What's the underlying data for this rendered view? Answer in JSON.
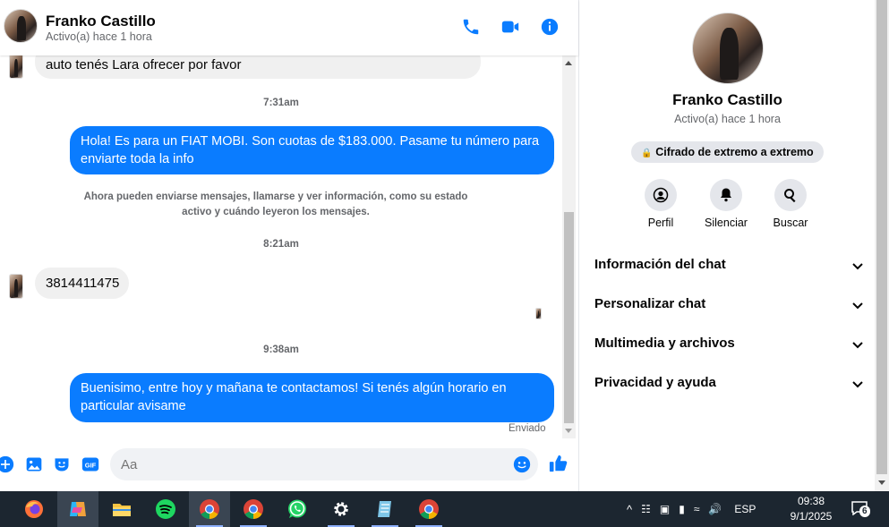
{
  "header": {
    "name": "Franko Castillo",
    "status": "Activo(a) hace 1 hora"
  },
  "messages": {
    "partial_in": "auto tenés Lara ofrecer por favor",
    "time1": "7:31am",
    "out1": "Hola! Es para un FIAT MOBI. Son cuotas de $183.000. Pasame tu número para enviarte toda la info",
    "system": "Ahora pueden enviarse mensajes, llamarse y ver información, como su estado activo y cuándo leyeron los mensajes.",
    "time2": "8:21am",
    "in2": "3814411475",
    "time3": "9:38am",
    "out2": "Buenisimo, entre hoy y mañana te contactamos! Si tenés algún horario en particular avisame",
    "sent_label": "Enviado"
  },
  "composer": {
    "placeholder": "Aa"
  },
  "info": {
    "name": "Franko Castillo",
    "status": "Activo(a) hace 1 hora",
    "encryption": "Cifrado de extremo a extremo",
    "actions": [
      {
        "label": "Perfil",
        "icon": "profile-icon"
      },
      {
        "label": "Silenciar",
        "icon": "bell-icon"
      },
      {
        "label": "Buscar",
        "icon": "search-icon"
      }
    ],
    "sections": [
      {
        "label": "Información del chat"
      },
      {
        "label": "Personalizar chat"
      },
      {
        "label": "Multimedia y archivos"
      },
      {
        "label": "Privacidad y ayuda"
      }
    ]
  },
  "taskbar": {
    "apps": [
      "firefox-icon",
      "copilot-icon",
      "file-explorer-icon",
      "spotify-icon",
      "chrome-icon",
      "chrome-icon",
      "whatsapp-icon",
      "settings-icon",
      "notepad-icon",
      "chrome-icon"
    ],
    "language": "ESP",
    "time": "09:38",
    "date": "9/1/2025",
    "notifications": "6"
  },
  "colors": {
    "accent": "#0a7cff",
    "incoming_bubble": "#f0f0f0",
    "taskbar": "#1c2630"
  }
}
